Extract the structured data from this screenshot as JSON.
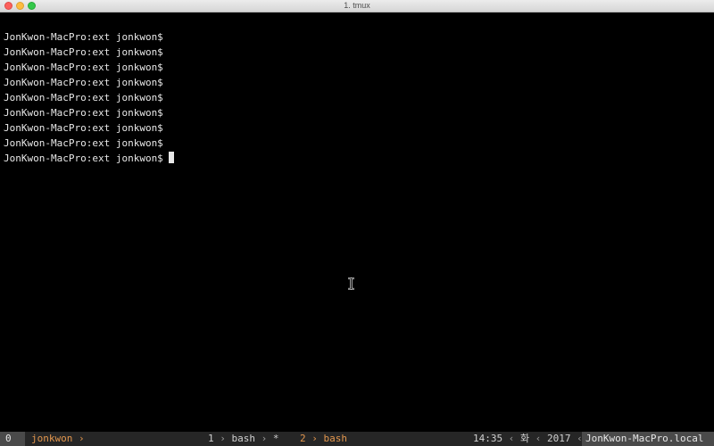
{
  "window": {
    "title": "1. tmux"
  },
  "terminal": {
    "lines": [
      "JonKwon-MacPro:ext jonkwon$",
      "JonKwon-MacPro:ext jonkwon$",
      "JonKwon-MacPro:ext jonkwon$",
      "JonKwon-MacPro:ext jonkwon$",
      "JonKwon-MacPro:ext jonkwon$",
      "JonKwon-MacPro:ext jonkwon$",
      "JonKwon-MacPro:ext jonkwon$",
      "JonKwon-MacPro:ext jonkwon$",
      "JonKwon-MacPro:ext jonkwon$"
    ]
  },
  "statusbar": {
    "session_index": "0",
    "session_name": "jonkwon",
    "windows": [
      {
        "index": "1",
        "name": "bash",
        "flag": "*"
      },
      {
        "index": "2",
        "name": "bash",
        "flag": ""
      }
    ],
    "time": "14:35",
    "day": "화",
    "year": "2017",
    "hostname": "JonKwon-MacPro.local"
  },
  "colors": {
    "background": "#000000",
    "foreground": "#e8e8e8",
    "statusbar_bg": "#262626",
    "accent_orange": "#e2964d",
    "segment_bg": "#4a4a4a"
  },
  "icons": {
    "cursor": "block-cursor-icon",
    "mouse_pointer": "ibeam-cursor-icon"
  }
}
